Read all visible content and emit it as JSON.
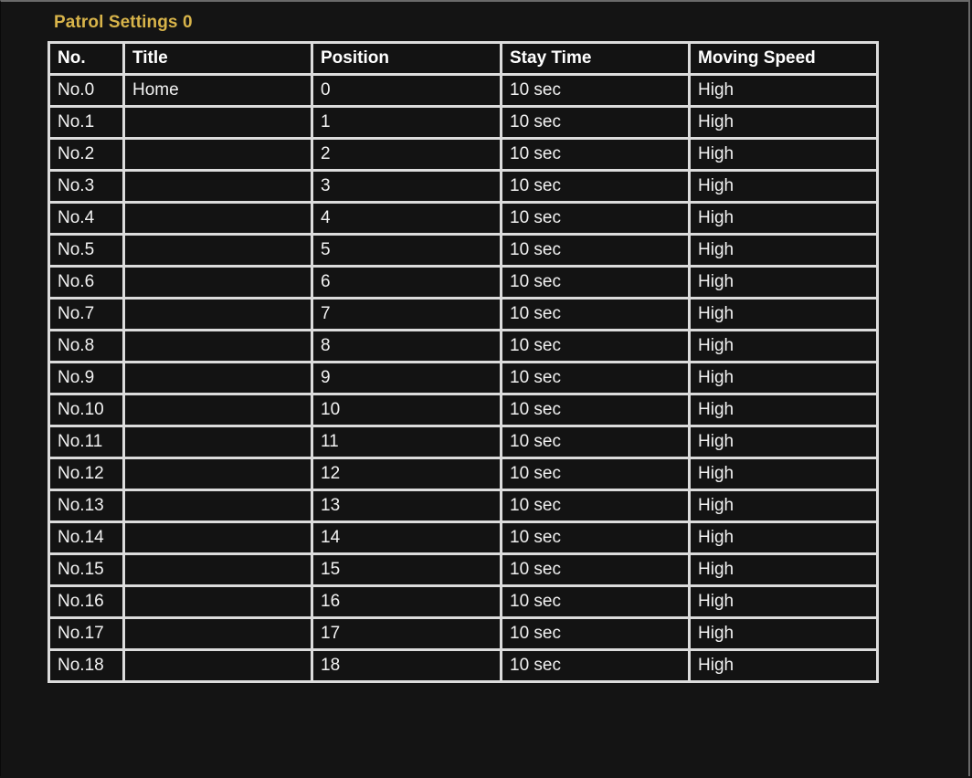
{
  "page": {
    "title": "Patrol Settings 0",
    "title_color": "#d8b44a"
  },
  "table": {
    "headers": {
      "no": "No.",
      "title": "Title",
      "position": "Position",
      "stay_time": "Stay Time",
      "moving_speed": "Moving Speed"
    },
    "rows": [
      {
        "no": "No.0",
        "title": "Home",
        "position": "0",
        "stay_time": "10 sec",
        "moving_speed": "High"
      },
      {
        "no": "No.1",
        "title": "",
        "position": "1",
        "stay_time": "10 sec",
        "moving_speed": "High"
      },
      {
        "no": "No.2",
        "title": "",
        "position": "2",
        "stay_time": "10 sec",
        "moving_speed": "High"
      },
      {
        "no": "No.3",
        "title": "",
        "position": "3",
        "stay_time": "10 sec",
        "moving_speed": "High"
      },
      {
        "no": "No.4",
        "title": "",
        "position": "4",
        "stay_time": "10 sec",
        "moving_speed": "High"
      },
      {
        "no": "No.5",
        "title": "",
        "position": "5",
        "stay_time": "10 sec",
        "moving_speed": "High"
      },
      {
        "no": "No.6",
        "title": "",
        "position": "6",
        "stay_time": "10 sec",
        "moving_speed": "High"
      },
      {
        "no": "No.7",
        "title": "",
        "position": "7",
        "stay_time": "10 sec",
        "moving_speed": "High"
      },
      {
        "no": "No.8",
        "title": "",
        "position": "8",
        "stay_time": "10 sec",
        "moving_speed": "High"
      },
      {
        "no": "No.9",
        "title": "",
        "position": "9",
        "stay_time": "10 sec",
        "moving_speed": "High"
      },
      {
        "no": "No.10",
        "title": "",
        "position": "10",
        "stay_time": "10 sec",
        "moving_speed": "High"
      },
      {
        "no": "No.11",
        "title": "",
        "position": "11",
        "stay_time": "10 sec",
        "moving_speed": "High"
      },
      {
        "no": "No.12",
        "title": "",
        "position": "12",
        "stay_time": "10 sec",
        "moving_speed": "High"
      },
      {
        "no": "No.13",
        "title": "",
        "position": "13",
        "stay_time": "10 sec",
        "moving_speed": "High"
      },
      {
        "no": "No.14",
        "title": "",
        "position": "14",
        "stay_time": "10 sec",
        "moving_speed": "High"
      },
      {
        "no": "No.15",
        "title": "",
        "position": "15",
        "stay_time": "10 sec",
        "moving_speed": "High"
      },
      {
        "no": "No.16",
        "title": "",
        "position": "16",
        "stay_time": "10 sec",
        "moving_speed": "High"
      },
      {
        "no": "No.17",
        "title": "",
        "position": "17",
        "stay_time": "10 sec",
        "moving_speed": "High"
      },
      {
        "no": "No.18",
        "title": "",
        "position": "18",
        "stay_time": "10 sec",
        "moving_speed": "High"
      }
    ]
  }
}
